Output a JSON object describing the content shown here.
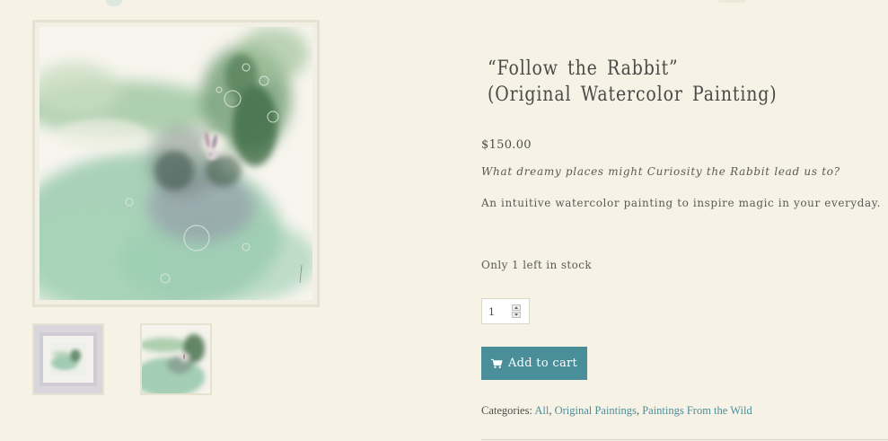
{
  "product": {
    "title_line1": "“Follow the Rabbit”",
    "title_line2": "(Original Watercolor Painting)",
    "price": "$150.00",
    "tagline": "What dreamy places might Curiosity the Rabbit lead us to?",
    "description": "An intuitive watercolor painting to inspire magic in your everyday.",
    "stock": "Only 1 left in stock",
    "quantity": "1",
    "add_to_cart_label": "Add to cart",
    "cart_icon": "cart-icon"
  },
  "categories": {
    "label": "Categories:",
    "items": [
      {
        "label": "All"
      },
      {
        "label": "Original Paintings"
      },
      {
        "label": "Paintings From the Wild"
      }
    ],
    "separator": ", "
  },
  "colors": {
    "accent": "#4a8e99",
    "background": "#f6f3e6",
    "frame": "#e6e2d2"
  }
}
